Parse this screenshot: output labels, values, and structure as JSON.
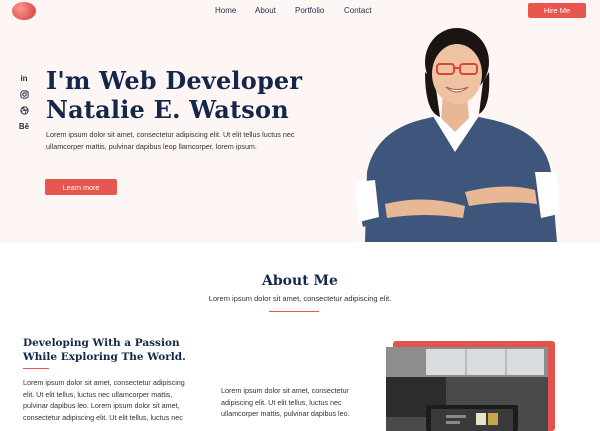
{
  "nav": {
    "items": [
      "Home",
      "About",
      "Portfolio",
      "Contact"
    ],
    "hire_label": "Hire Me"
  },
  "social": [
    "in",
    "instagram-icon",
    "dribbble-icon",
    "Bē"
  ],
  "hero": {
    "headline_line1": "I'm Web Developer",
    "headline_line2": "Natalie E. Watson",
    "text": "Lorem ipsum dolor sit amet, consectetur adipiscing elit. Ut elit tellus luctus nec ullamcorper mattis, pulvinar dapibus leop llamcorper, lorem ipsum.",
    "cta_label": "Learn more"
  },
  "about": {
    "title": "About Me",
    "subtitle": "Lorem ipsum dolor sit amet, consectetur adipiscing elit.",
    "heading_line1": "Developing With a Passion",
    "heading_line2": "While Exploring The World.",
    "col1": "Lorem ipsum dolor sit amet, consectetur adipiscing elit. Ut elit tellus, luctus nec ullamcorper mattis, pulvinar dapibus leo. Lorem ipsum dolor sit amet, consectetur adipiscing elit. Ut elit tellus, luctus nec",
    "col2": "Lorem ipsum dolor sit amet, consectetur adipiscing elit. Ut elit tellus, luctus nec ullamcorper mattis, pulvinar dapibus leo."
  },
  "colors": {
    "accent": "#e8574f",
    "navy": "#13274a",
    "hero_bg": "#fdf6f5"
  }
}
